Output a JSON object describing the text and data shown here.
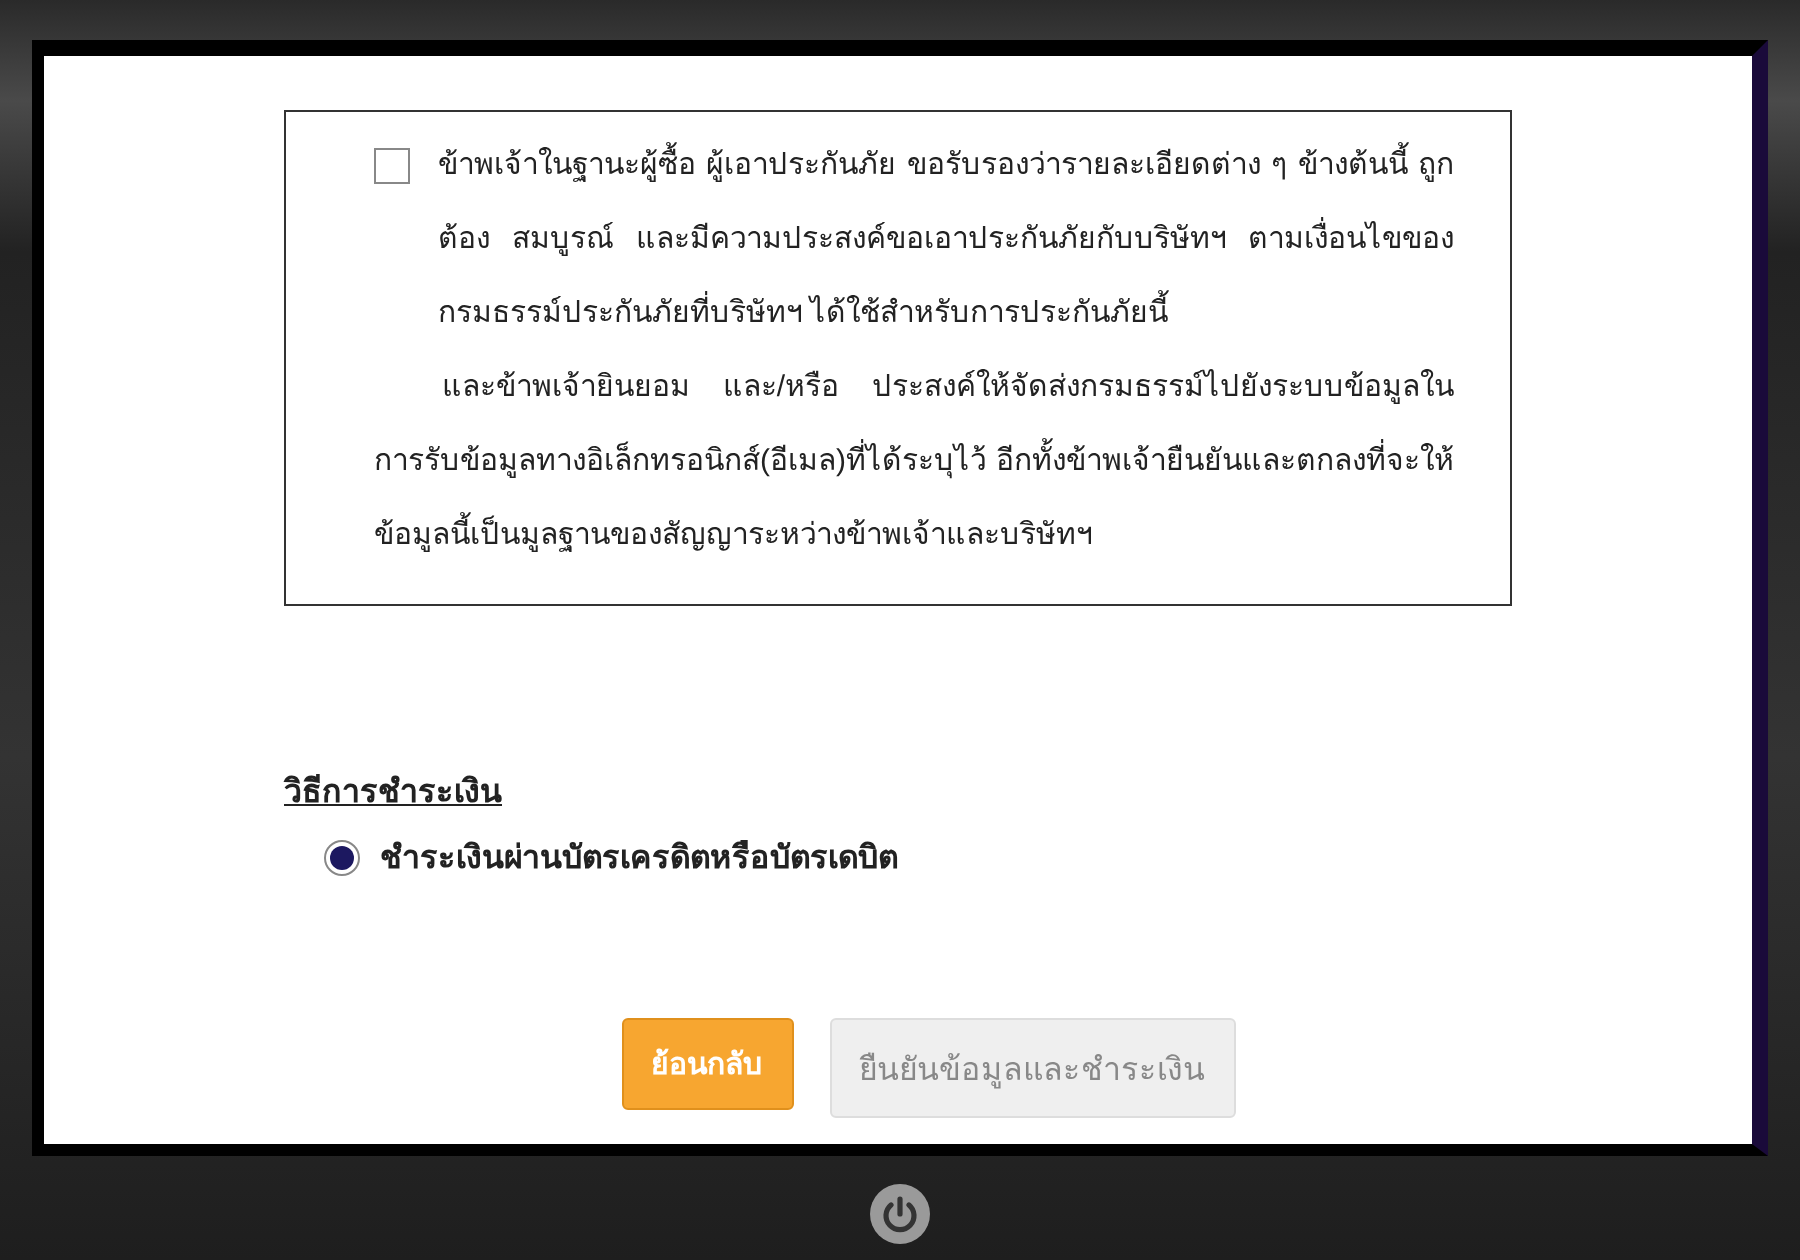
{
  "consent": {
    "checked": false,
    "paragraphs": [
      "ข้าพเจ้าในฐานะผู้ซื้อ ผู้เอาประกันภัย ขอรับรองว่ารายละเอียดต่าง ๆ ข้างต้นนี้ ถูกต้อง สมบูรณ์ และมีความประสงค์ขอเอาประกันภัยกับบริษัทฯ ตามเงื่อนไขของกรมธรรม์ประกันภัยที่บริษัทฯ ได้ใช้สำหรับการประกันภัยนี้",
      "และข้าพเจ้ายินยอม และ/หรือ ประสงค์ให้จัดส่งกรมธรรม์ไปยังระบบข้อมูลในการรับข้อมูลทางอิเล็กทรอนิกส์(อีเมล)ที่ได้ระบุไว้ อีกทั้งข้าพเจ้ายืนยันและตกลงที่จะให้ข้อมูลนี้เป็นมูลฐานของสัญญาระหว่างข้าพเจ้าและบริษัทฯ"
    ]
  },
  "payment": {
    "heading": "วิธีการชำระเงิน",
    "options": [
      {
        "label": "ชำระเงินผ่านบัตรเครดิตหรือบัตรเดบิต",
        "selected": true
      }
    ]
  },
  "buttons": [
    {
      "label": "ย้อนกลับ",
      "disabled": false
    },
    {
      "label": "ยืนยันข้อมูลและชำระเงิน",
      "disabled": true
    }
  ]
}
